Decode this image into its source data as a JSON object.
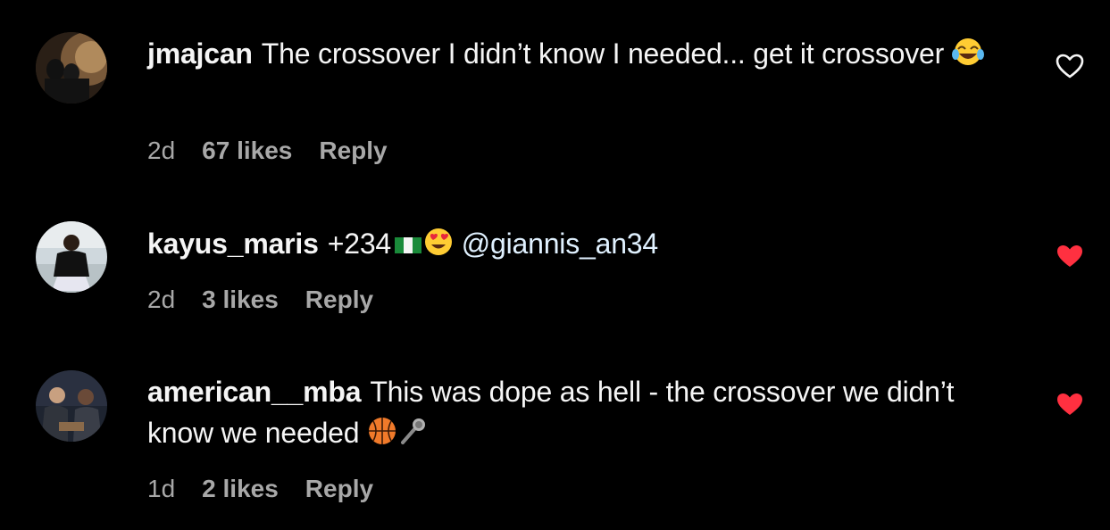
{
  "comments": [
    {
      "username": "jmajcan",
      "text": "The crossover I didn’t know I needed... get it crossover",
      "emoji": "face-with-tears-of-joy",
      "time": "2d",
      "likes": "67 likes",
      "reply_label": "Reply",
      "liked": false
    },
    {
      "username": "kayus_maris",
      "text": "+234",
      "emoji": "nigeria-flag, heart-eyes",
      "mention": "@giannis_an34",
      "time": "2d",
      "likes": "3 likes",
      "reply_label": "Reply",
      "liked": true
    },
    {
      "username": "american__mba",
      "text": "This was dope as hell - the crossover we didn’t know we needed",
      "emoji": "basketball, microphone",
      "time": "1d",
      "likes": "2 likes",
      "reply_label": "Reply",
      "liked": true
    }
  ],
  "colors": {
    "background": "#000000",
    "text": "#f5f5f5",
    "meta": "#a8a8a8",
    "liked_heart": "#ff3040",
    "mention": "#e0f1ff"
  }
}
